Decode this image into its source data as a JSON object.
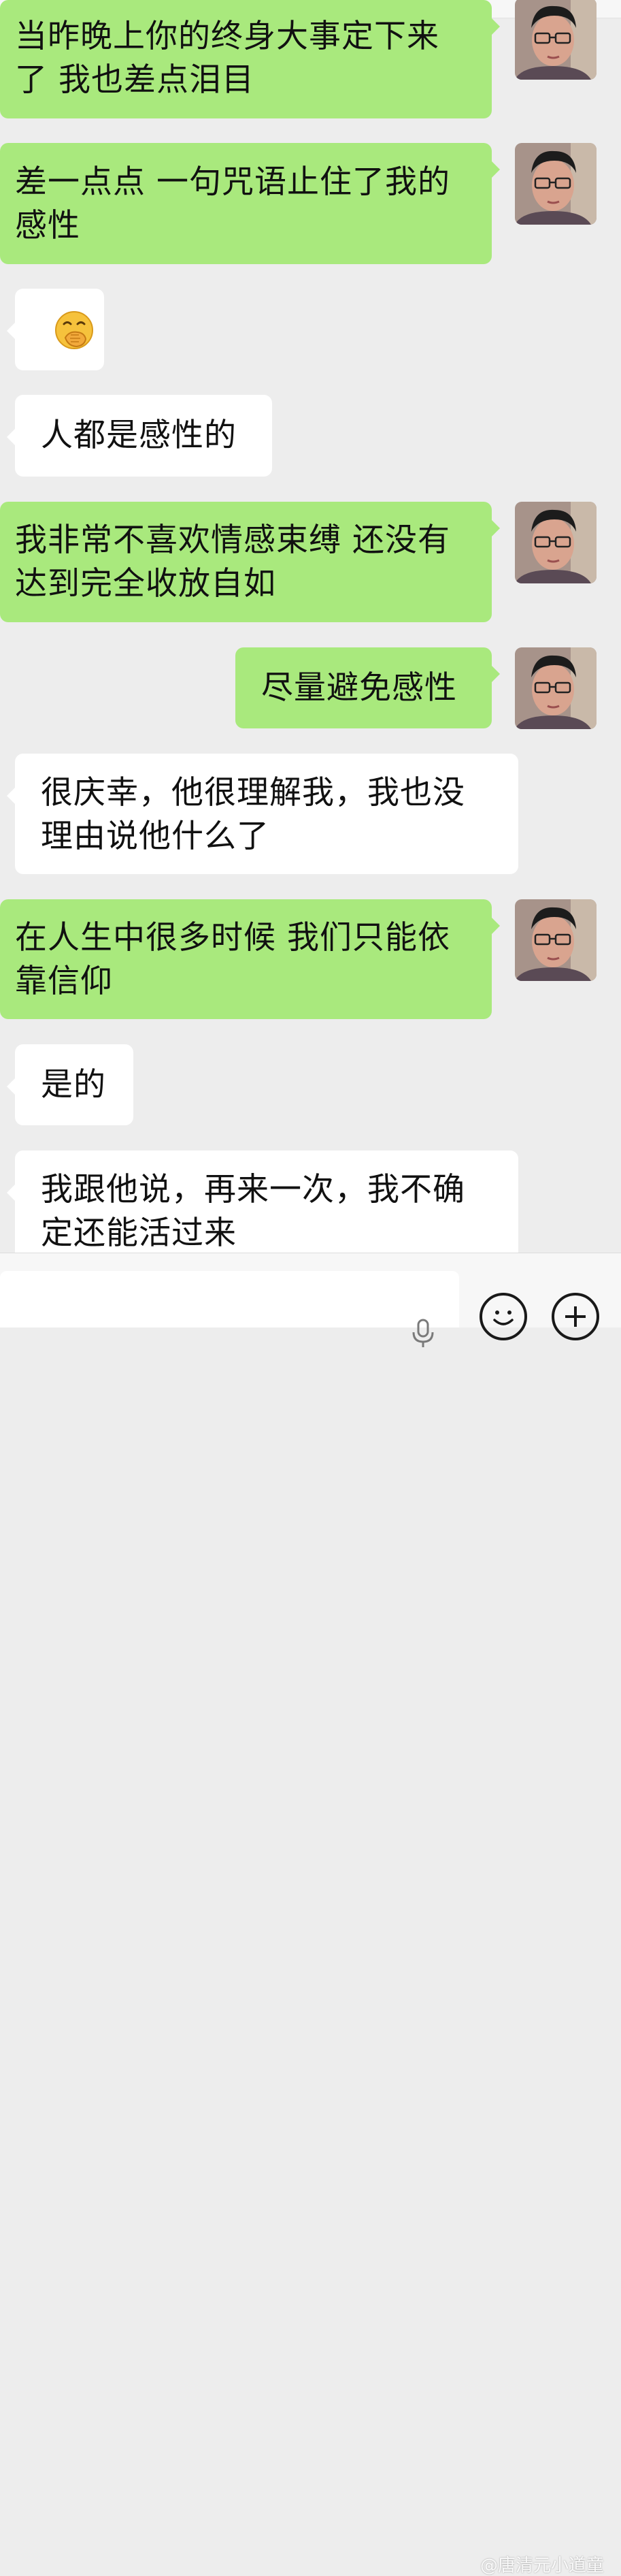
{
  "messages": [
    {
      "side": "out",
      "text": "当昨晚上你的终身大事定下来了 我也差点泪目"
    },
    {
      "side": "out",
      "text": "差一点点 一句咒语止住了我的感性"
    },
    {
      "side": "in",
      "emoji": "face-with-hand-over-mouth"
    },
    {
      "side": "in",
      "text": "人都是感性的"
    },
    {
      "side": "out",
      "text": "我非常不喜欢情感束缚 还没有达到完全收放自如"
    },
    {
      "side": "out",
      "text": "尽量避免感性"
    },
    {
      "side": "in",
      "text": "很庆幸，他很理解我，我也没理由说他什么了"
    },
    {
      "side": "out",
      "text": "在人生中很多时候 我们只能依靠信仰"
    },
    {
      "side": "in",
      "text": "是的"
    },
    {
      "side": "in",
      "text": "我跟他说，再来一次，我不确定还能活过来"
    }
  ],
  "input_bar": {
    "mic_icon": "microphone-icon",
    "emoji_icon": "smiley-icon",
    "plus_icon": "plus-icon"
  },
  "watermark": "@唐清元小道童",
  "colors": {
    "background": "#ededed",
    "outgoing_bubble": "#a9e97d",
    "incoming_bubble": "#ffffff"
  }
}
